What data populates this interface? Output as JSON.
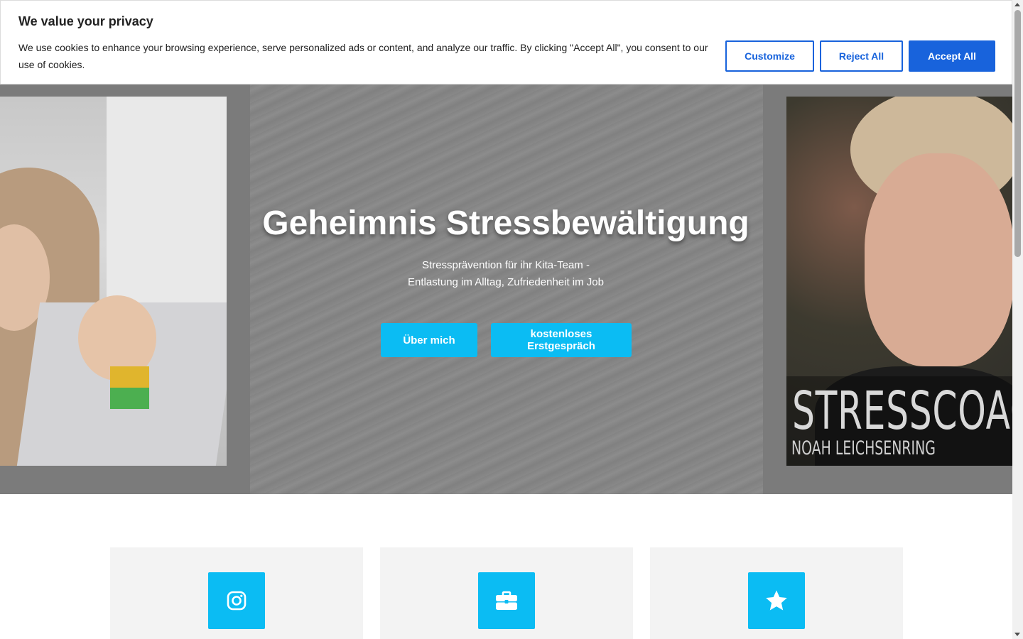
{
  "cookie_banner": {
    "title": "We value your privacy",
    "text": "We use cookies to enhance your browsing experience, serve personalized ads or content, and analyze our traffic. By clicking \"Accept All\", you consent to our use of cookies.",
    "customize_label": "Customize",
    "reject_label": "Reject All",
    "accept_label": "Accept All",
    "accent_color": "#1863dc"
  },
  "hero": {
    "title": "Geheimnis Stressbewältigung",
    "subtitle_line1": "Stressprävention für ihr Kita-Team -",
    "subtitle_line2": "Entlastung im Alltag, Zufriedenheit im Job",
    "button_about": "Über mich",
    "button_consult": "kostenloses Erstgespräch",
    "button_color": "#0bbcf3",
    "right_image_title": "STRESSCOACH",
    "right_image_name": "NOAH LEICHSENRING"
  },
  "features": [
    {
      "icon": "instagram-icon"
    },
    {
      "icon": "briefcase-icon"
    },
    {
      "icon": "star-icon"
    }
  ]
}
